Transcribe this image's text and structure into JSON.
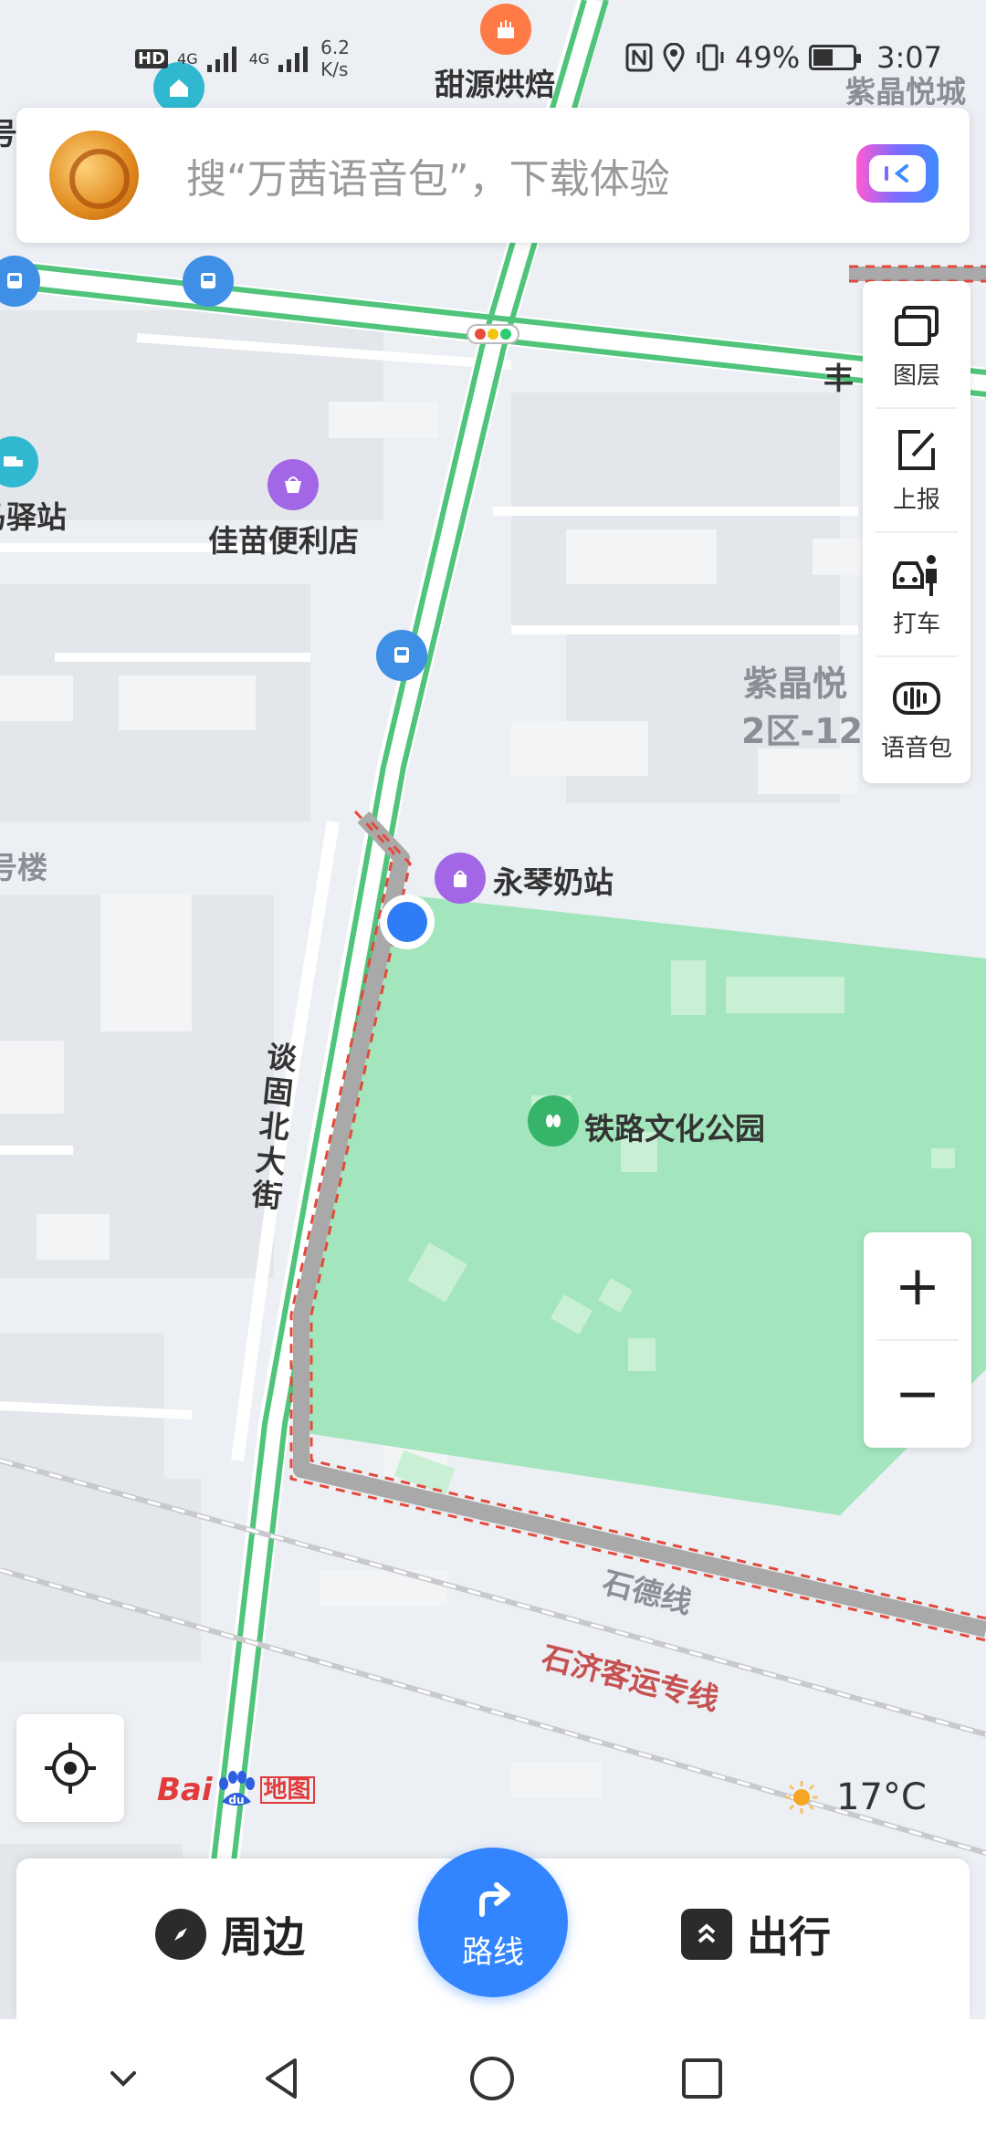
{
  "status_bar": {
    "network_badge": "HD",
    "signal_1": "4G",
    "signal_2": "4G",
    "speed_value": "6.2",
    "speed_unit": "K/s",
    "battery": "49%",
    "battery_level": 0.49,
    "time": "3:07"
  },
  "search": {
    "placeholder": "搜“万茜语音包”，下载体验"
  },
  "tools": [
    {
      "label": "图层",
      "icon": "layers-icon"
    },
    {
      "label": "上报",
      "icon": "report-icon"
    },
    {
      "label": "打车",
      "icon": "taxi-icon"
    },
    {
      "label": "语音包",
      "icon": "voice-pack-icon"
    }
  ],
  "zoom": {
    "in": "+",
    "out": "−"
  },
  "map": {
    "labels": {
      "bakery": "甜源烘焙",
      "ziJing_top": "紫晶悦城",
      "feng": "丰",
      "haoLeft": "号",
      "yizhan": "马驿站",
      "jiamiao": "佳苗便利店",
      "ziJing_mid": "紫晶悦",
      "district": "2区-12",
      "haolou": "号楼",
      "milkStation": "永琴奶站",
      "street": "谈固北大街",
      "park": "铁路文化公园",
      "shide": "石德线",
      "shiji": "石济客运专线"
    },
    "colors": {
      "park": "#a3e5bc",
      "road_green": "#4fc47a",
      "route_gray": "#a9a9a9",
      "route_red": "#e24a3b",
      "location_blue": "#2f7df6"
    }
  },
  "logo": {
    "bai": "Bai",
    "du": "du",
    "ditu": "地图"
  },
  "weather": {
    "temp": "17°C",
    "icon": "sun-icon"
  },
  "bottom": {
    "nearby": "周边",
    "route": "路线",
    "travel": "出行"
  },
  "nav": [
    "back-chevron-icon",
    "back-triangle-icon",
    "home-circle-icon",
    "recents-square-icon"
  ]
}
